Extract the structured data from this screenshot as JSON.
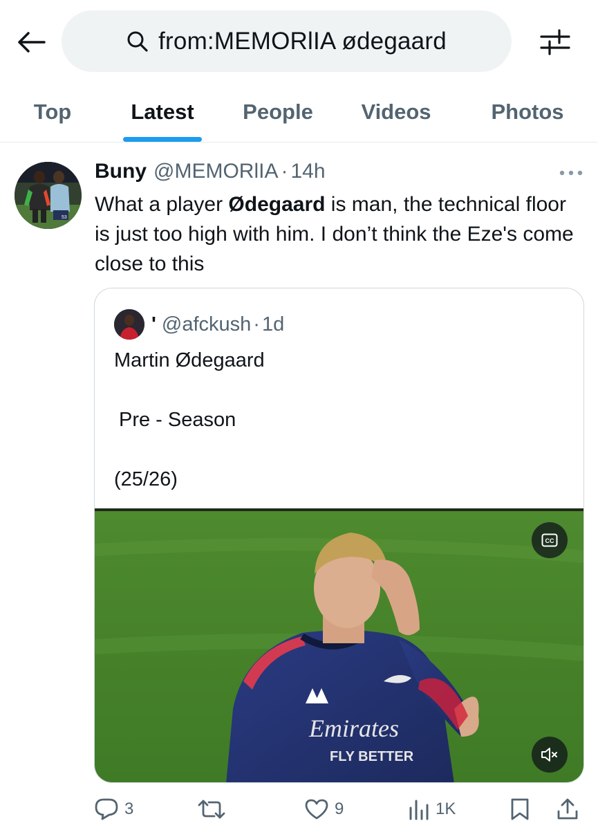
{
  "search": {
    "query": "from:MEMORlIA ødegaard"
  },
  "tabs": [
    {
      "label": "Top",
      "active": false
    },
    {
      "label": "Latest",
      "active": true
    },
    {
      "label": "People",
      "active": false
    },
    {
      "label": "Videos",
      "active": false
    },
    {
      "label": "Photos",
      "active": false
    }
  ],
  "tweet": {
    "display_name": "Buny",
    "handle": "@MEMORlIA",
    "separator": "·",
    "time": "14h",
    "text_before": "What a player ",
    "text_bold": "Ødegaard",
    "text_after": " is man, the technical floor is just too high with him. I don’t think the Eze's come close to this",
    "quote": {
      "display_name": "'",
      "handle": "@afckush",
      "separator": "·",
      "time": "1d",
      "lines": [
        "Martin Ødegaard",
        "Pre - Season",
        "(25/26)"
      ],
      "media": {
        "captions_label": "CC",
        "captions_icon": "closed-captions-icon",
        "mute_icon": "volume-muted-icon"
      }
    },
    "actions": {
      "replies": "3",
      "reposts": "",
      "likes": "9",
      "views": "1K"
    }
  },
  "colors": {
    "accent": "#1d9bf0",
    "text_primary": "#0f1419",
    "text_secondary": "#536471",
    "search_bg": "#eff3f4",
    "border": "#cfd9de"
  },
  "icons": {
    "back": "arrow-left-icon",
    "search": "search-icon",
    "filter": "sliders-icon",
    "more": "more-dots-icon",
    "reply": "reply-icon",
    "repost": "repost-icon",
    "like": "heart-icon",
    "views": "views-chart-icon",
    "bookmark": "bookmark-icon",
    "share": "share-icon"
  }
}
